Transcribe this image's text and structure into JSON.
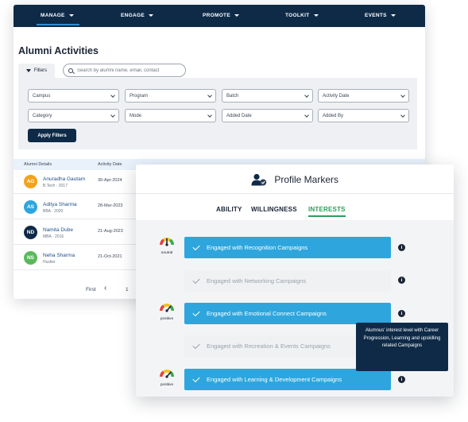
{
  "nav": {
    "items": [
      {
        "label": "MANAGE"
      },
      {
        "label": "ENGAGE"
      },
      {
        "label": "PROMOTE"
      },
      {
        "label": "TOOLKIT"
      },
      {
        "label": "EVENTS"
      }
    ]
  },
  "page": {
    "title": "Alumni Activities",
    "filters_tab": "Filters",
    "search_placeholder": "Search by alumni name, email, contact",
    "apply_button": "Apply Filters"
  },
  "filters": [
    {
      "label": "Campus"
    },
    {
      "label": "Program"
    },
    {
      "label": "Batch"
    },
    {
      "label": "Activity Date"
    },
    {
      "label": "Category"
    },
    {
      "label": "Mode"
    },
    {
      "label": "Added Date"
    },
    {
      "label": "Added By"
    }
  ],
  "table": {
    "headers": {
      "details": "Alumni Details",
      "date": "Activity Date"
    },
    "rows": [
      {
        "initials": "AG",
        "name": "Anuradha Gautam",
        "sub": "B.Tech · 2017",
        "date": "30-Apr-2024",
        "color": "#f2a21b"
      },
      {
        "initials": "AS",
        "name": "Aditya Sharma",
        "sub": "BBA · 2020",
        "date": "28-Mar-2023",
        "color": "#2ea6dd"
      },
      {
        "initials": "ND",
        "name": "Namita Dube",
        "sub": "MBA · 2016",
        "date": "21-Aug-2023",
        "color": "#0e2a47"
      },
      {
        "initials": "NS",
        "name": "Neha Sharma",
        "sub": "Hustler",
        "date": "21-Oct-2021",
        "color": "#5cb85c"
      }
    ]
  },
  "pager": {
    "first": "First",
    "prev": "‹",
    "page": "1"
  },
  "profile": {
    "title": "Profile Markers",
    "tabs": [
      {
        "label": "ABILITY"
      },
      {
        "label": "WILLINGNESS"
      },
      {
        "label": "INTERESTS"
      }
    ],
    "markers": [
      {
        "label": "Engaged with Recognition Campaigns",
        "on": true
      },
      {
        "label": "Engaged with Networking Campaigns",
        "on": false
      },
      {
        "label": "Engaged with Emotional Connect Campaigns",
        "on": true
      },
      {
        "label": "Engaged with Recreation & Events Campaigns",
        "on": false
      },
      {
        "label": "Engaged with Learning & Development Campaigns",
        "on": true
      }
    ],
    "gauges": [
      {
        "label": "neutral"
      },
      {
        "label": "positive"
      },
      {
        "label": "positive"
      }
    ],
    "info_icon": "i",
    "tooltip": "Alumnus' interest level with Career Progression, Learning and upskilling related Campaigns"
  },
  "colors": {
    "navy": "#0e2a47",
    "accent_blue": "#2ea6dd",
    "accent_green": "#2e9c5a"
  }
}
